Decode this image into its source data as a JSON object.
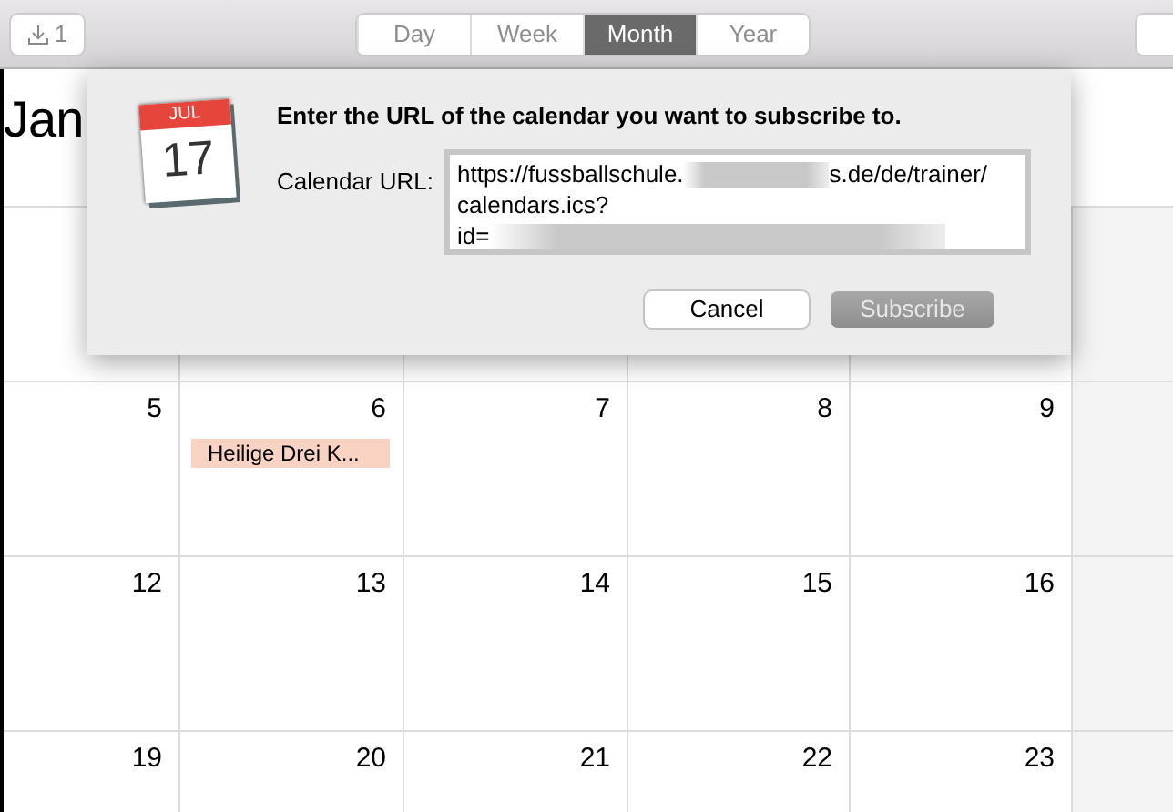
{
  "toolbar": {
    "inbox_count": "1",
    "views": [
      {
        "label": "Day",
        "selected": false
      },
      {
        "label": "Week",
        "selected": false
      },
      {
        "label": "Month",
        "selected": true
      },
      {
        "label": "Year",
        "selected": false
      }
    ]
  },
  "calendar": {
    "month_title": "Jan",
    "weeks": [
      {
        "days": [
          {
            "day": "5"
          },
          {
            "day": "6",
            "events": [
              {
                "title": "Heilige Drei K...",
                "color": "#f8d3c4"
              }
            ]
          },
          {
            "day": "7"
          },
          {
            "day": "8"
          },
          {
            "day": "9"
          }
        ]
      },
      {
        "days": [
          {
            "day": "12"
          },
          {
            "day": "13"
          },
          {
            "day": "14"
          },
          {
            "day": "15"
          },
          {
            "day": "16"
          }
        ]
      },
      {
        "days": [
          {
            "day": "19"
          },
          {
            "day": "20"
          },
          {
            "day": "21"
          },
          {
            "day": "22"
          },
          {
            "day": "23"
          }
        ]
      }
    ]
  },
  "dialog": {
    "icon_month": "JUL",
    "icon_day": "17",
    "message": "Enter the URL of the calendar you want to subscribe to.",
    "field_label": "Calendar URL:",
    "url_lines": [
      [
        {
          "kind": "text",
          "text": "https://fussballschule."
        },
        {
          "kind": "redacted"
        },
        {
          "kind": "text",
          "text": "s.de/de/trainer/"
        }
      ],
      [
        {
          "kind": "text",
          "text": "calendars.ics?"
        }
      ],
      [
        {
          "kind": "text",
          "text": "id="
        },
        {
          "kind": "redacted"
        }
      ]
    ],
    "buttons": [
      {
        "label": "Cancel",
        "disabled": false
      },
      {
        "label": "Subscribe",
        "disabled": true
      }
    ]
  }
}
